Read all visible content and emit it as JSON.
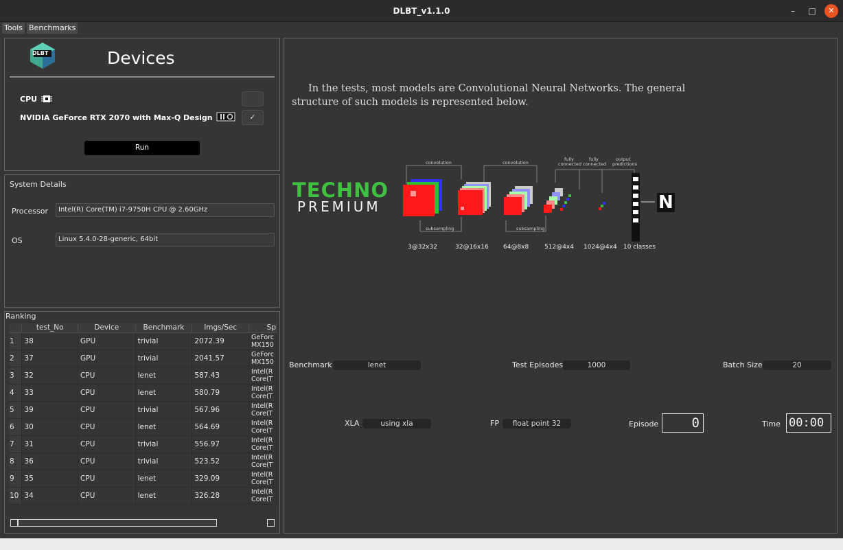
{
  "window": {
    "title": "DLBT_v1.1.0",
    "minimize_glyph": "–",
    "maximize_glyph": "□",
    "close_glyph": "✕"
  },
  "menu": {
    "tools": "Tools",
    "benchmarks": "Benchmarks"
  },
  "devices": {
    "logo_text": "DLBT",
    "title": "Devices",
    "cpu_label": "CPU",
    "cpu_checked": false,
    "cpu_check_glyph": "",
    "gpu_label": "NVIDIA GeForce RTX 2070 with Max-Q Design",
    "gpu_checked": true,
    "gpu_check_glyph": "✓",
    "run_label": "Run"
  },
  "system": {
    "title": "System Details",
    "processor_label": "Processor",
    "processor_value": "Intel(R) Core(TM) i7-9750H CPU @ 2.60GHz",
    "os_label": "OS",
    "os_value": "Linux 5.4.0-28-generic, 64bit"
  },
  "ranking": {
    "title": "Ranking",
    "columns": [
      "test_No",
      "Device",
      "Benchmark",
      "Imgs/Sec",
      "Sp"
    ],
    "rows": [
      {
        "n": "1",
        "test_no": "38",
        "device": "GPU",
        "benchmark": "trivial",
        "ips": "2072.39",
        "sp1": "GeForc",
        "sp2": "MX150"
      },
      {
        "n": "2",
        "test_no": "37",
        "device": "GPU",
        "benchmark": "trivial",
        "ips": "2041.57",
        "sp1": "GeForc",
        "sp2": "MX150"
      },
      {
        "n": "3",
        "test_no": "32",
        "device": "CPU",
        "benchmark": "lenet",
        "ips": "587.43",
        "sp1": "Intel(R",
        "sp2": "Core(T"
      },
      {
        "n": "4",
        "test_no": "33",
        "device": "CPU",
        "benchmark": "lenet",
        "ips": "580.79",
        "sp1": "Intel(R",
        "sp2": "Core(T"
      },
      {
        "n": "5",
        "test_no": "39",
        "device": "CPU",
        "benchmark": "trivial",
        "ips": "567.96",
        "sp1": "Intel(R",
        "sp2": "Core(T"
      },
      {
        "n": "6",
        "test_no": "30",
        "device": "CPU",
        "benchmark": "lenet",
        "ips": "564.69",
        "sp1": "Intel(R",
        "sp2": "Core(T"
      },
      {
        "n": "7",
        "test_no": "31",
        "device": "CPU",
        "benchmark": "trivial",
        "ips": "556.97",
        "sp1": "Intel(R",
        "sp2": "Core(T"
      },
      {
        "n": "8",
        "test_no": "36",
        "device": "CPU",
        "benchmark": "trivial",
        "ips": "523.52",
        "sp1": "Intel(R",
        "sp2": "Core(T"
      },
      {
        "n": "9",
        "test_no": "35",
        "device": "CPU",
        "benchmark": "lenet",
        "ips": "329.09",
        "sp1": "Intel(R",
        "sp2": "Core(T"
      },
      {
        "n": "10",
        "test_no": "34",
        "device": "CPU",
        "benchmark": "lenet",
        "ips": "326.28",
        "sp1": "Intel(R",
        "sp2": "Core(T"
      }
    ]
  },
  "main": {
    "intro_line1": "In the tests, most models are Convolutional Neural Networks. The general",
    "intro_line2": "structure of such models is represented below.",
    "watermark_line1": "TECHNO",
    "watermark_line2": "PREMIUM",
    "watermark_n": "N",
    "diagram": {
      "convolution": "convolution",
      "subsampling": "subsampling",
      "fully_connected": [
        "fully",
        "connected"
      ],
      "output_predictions": [
        "output",
        "predictions"
      ],
      "layer_labels": [
        "3@32x32",
        "32@16x16",
        "64@8x8",
        "512@4x4",
        "1024@4x4",
        "10 classes"
      ]
    },
    "benchmark_label": "Benchmark",
    "benchmark_value": "lenet",
    "episodes_label": "Test Episodes",
    "episodes_value": "1000",
    "batch_label": "Batch Size",
    "batch_value": "20",
    "xla_label": "XLA",
    "xla_value": "using xla",
    "fp_label": "FP",
    "fp_value": "float point 32",
    "episode_label": "Episode",
    "episode_value": "0",
    "time_label": "Time",
    "time_value": "00:00"
  },
  "colors": {
    "accent": "#e95420",
    "panel": "#353535",
    "feature_map": "#ff1a1a",
    "techno_green": "#40c040"
  }
}
